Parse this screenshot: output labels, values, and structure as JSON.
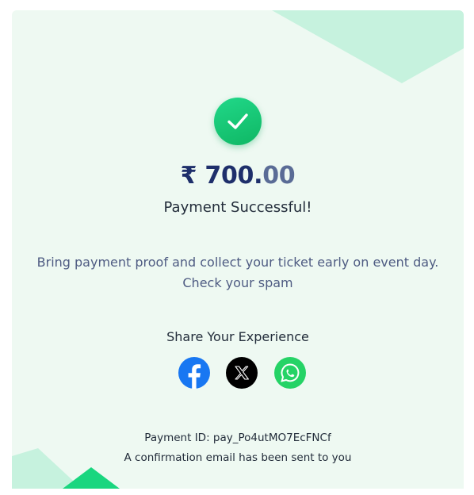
{
  "payment": {
    "currency_symbol": "₹",
    "amount_whole": "700.",
    "amount_paise": "00",
    "status": "Payment Successful!"
  },
  "info": {
    "line1": "Bring payment proof and collect your ticket early on event day.",
    "line2": "Check your spam"
  },
  "share": {
    "title": "Share Your Experience",
    "icons": [
      "facebook-icon",
      "x-icon",
      "whatsapp-icon"
    ]
  },
  "footer": {
    "payment_id": "Payment ID: pay_Po4utMO7EcFNCf",
    "confirmation": "A confirmation email has been sent to you"
  },
  "colors": {
    "card_bg": "#eef9f2",
    "success_green": "#14c46e",
    "amount_navy": "#1e2f6b",
    "deco_green_light": "#c6f2de",
    "deco_green_dark": "#19d67f"
  }
}
